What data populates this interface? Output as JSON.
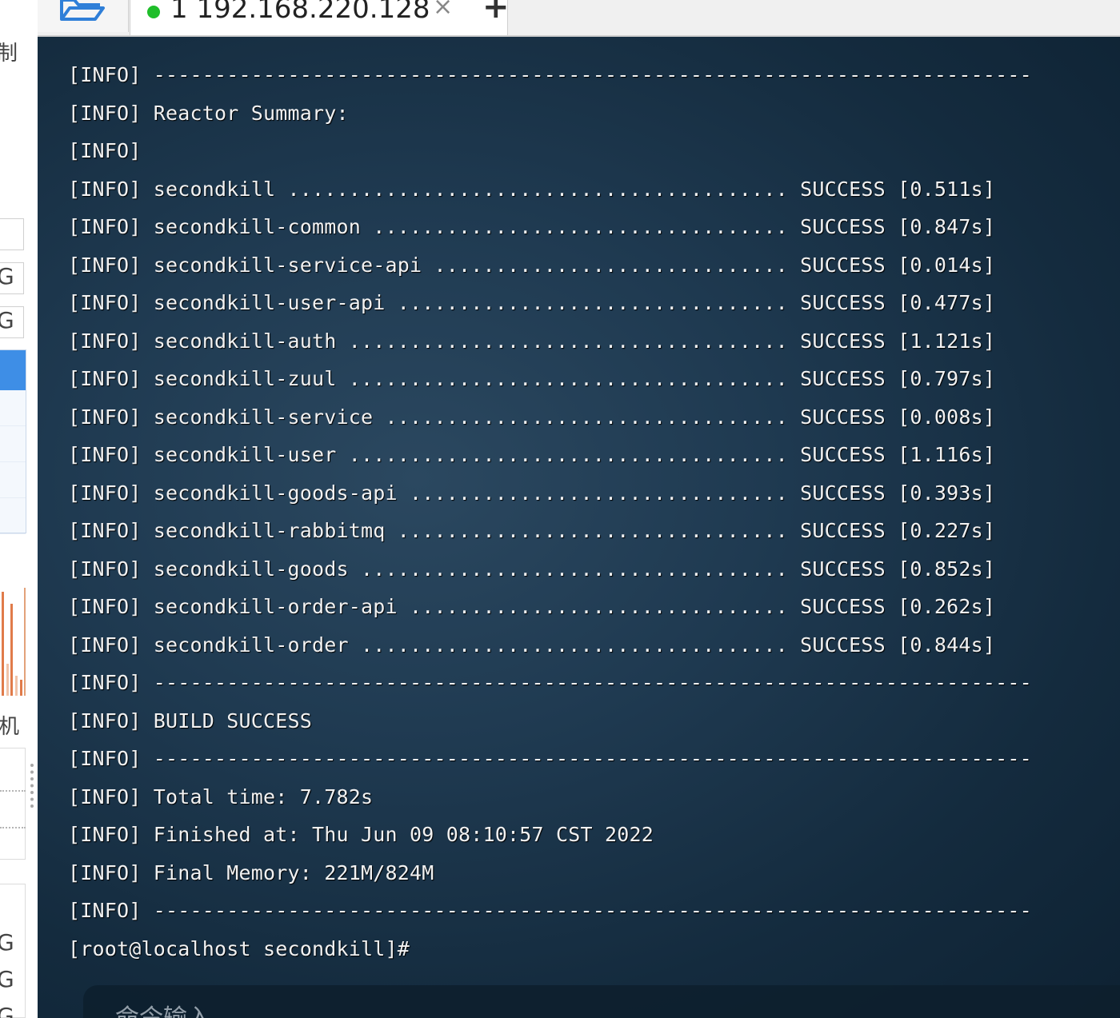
{
  "left_panel": {
    "label_top": "制",
    "label_g1": "G",
    "label_g2": "G",
    "label_machine": "机",
    "label_g3": "G",
    "label_g4": "G",
    "label_g5": "G"
  },
  "tabbar": {
    "folder_icon": "folder-open-icon",
    "tab_index": "1",
    "tab_host": "192.168.220.128",
    "tab_status_color": "#1fbe2a",
    "close_glyph": "×",
    "add_glyph": "+"
  },
  "terminal": {
    "lines": [
      "[INFO] ------------------------------------------------------------------------",
      "[INFO] Reactor Summary:",
      "[INFO]",
      "[INFO] secondkill ......................................... SUCCESS [0.511s]",
      "[INFO] secondkill-common .................................. SUCCESS [0.847s]",
      "[INFO] secondkill-service-api ............................. SUCCESS [0.014s]",
      "[INFO] secondkill-user-api ................................ SUCCESS [0.477s]",
      "[INFO] secondkill-auth .................................... SUCCESS [1.121s]",
      "[INFO] secondkill-zuul .................................... SUCCESS [0.797s]",
      "[INFO] secondkill-service ................................. SUCCESS [0.008s]",
      "[INFO] secondkill-user .................................... SUCCESS [1.116s]",
      "[INFO] secondkill-goods-api ............................... SUCCESS [0.393s]",
      "[INFO] secondkill-rabbitmq ................................ SUCCESS [0.227s]",
      "[INFO] secondkill-goods ................................... SUCCESS [0.852s]",
      "[INFO] secondkill-order-api ............................... SUCCESS [0.262s]",
      "[INFO] secondkill-order ................................... SUCCESS [0.844s]",
      "[INFO] ------------------------------------------------------------------------",
      "[INFO] BUILD SUCCESS",
      "[INFO] ------------------------------------------------------------------------",
      "[INFO] Total time: 7.782s",
      "[INFO] Finished at: Thu Jun 09 08:10:57 CST 2022",
      "[INFO] Final Memory: 221M/824M",
      "[INFO] ------------------------------------------------------------------------",
      "[root@localhost secondkill]#"
    ],
    "command_input_placeholder": "命令输入"
  }
}
